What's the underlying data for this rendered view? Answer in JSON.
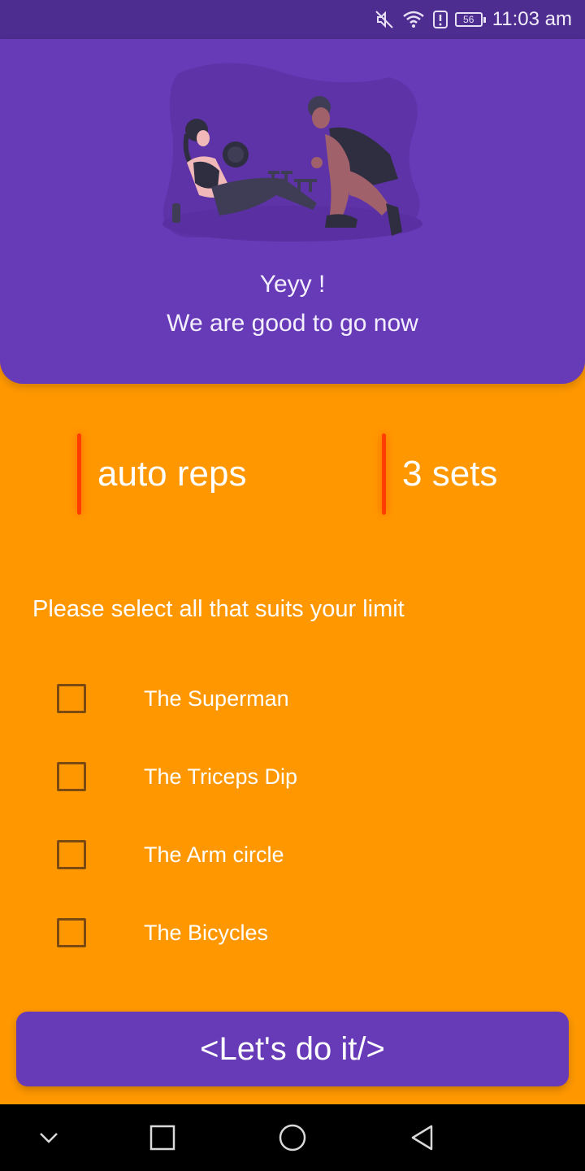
{
  "status_bar": {
    "time": "11:03 am",
    "battery_level": "56",
    "icons": [
      "mute-icon",
      "wifi-icon",
      "alert-icon",
      "battery-icon"
    ]
  },
  "header": {
    "illustration": "workout-illustration",
    "title": "Yeyy !",
    "subtitle": "We are good to go now"
  },
  "stats": [
    {
      "label": "auto reps"
    },
    {
      "label": "3 sets"
    }
  ],
  "prompt": "Please select all that suits your limit",
  "options": [
    {
      "label": "The Superman",
      "checked": false
    },
    {
      "label": "The Triceps Dip",
      "checked": false
    },
    {
      "label": "The Arm circle",
      "checked": false
    },
    {
      "label": "The Bicycles",
      "checked": false
    }
  ],
  "cta_label": "<Let's do it/>",
  "colors": {
    "primary": "#673AB7",
    "status_bar": "#4D2D8F",
    "background": "#FF9800",
    "accent": "#FF3D00"
  },
  "nav": [
    "collapse-icon",
    "recents-icon",
    "home-icon",
    "back-icon"
  ]
}
